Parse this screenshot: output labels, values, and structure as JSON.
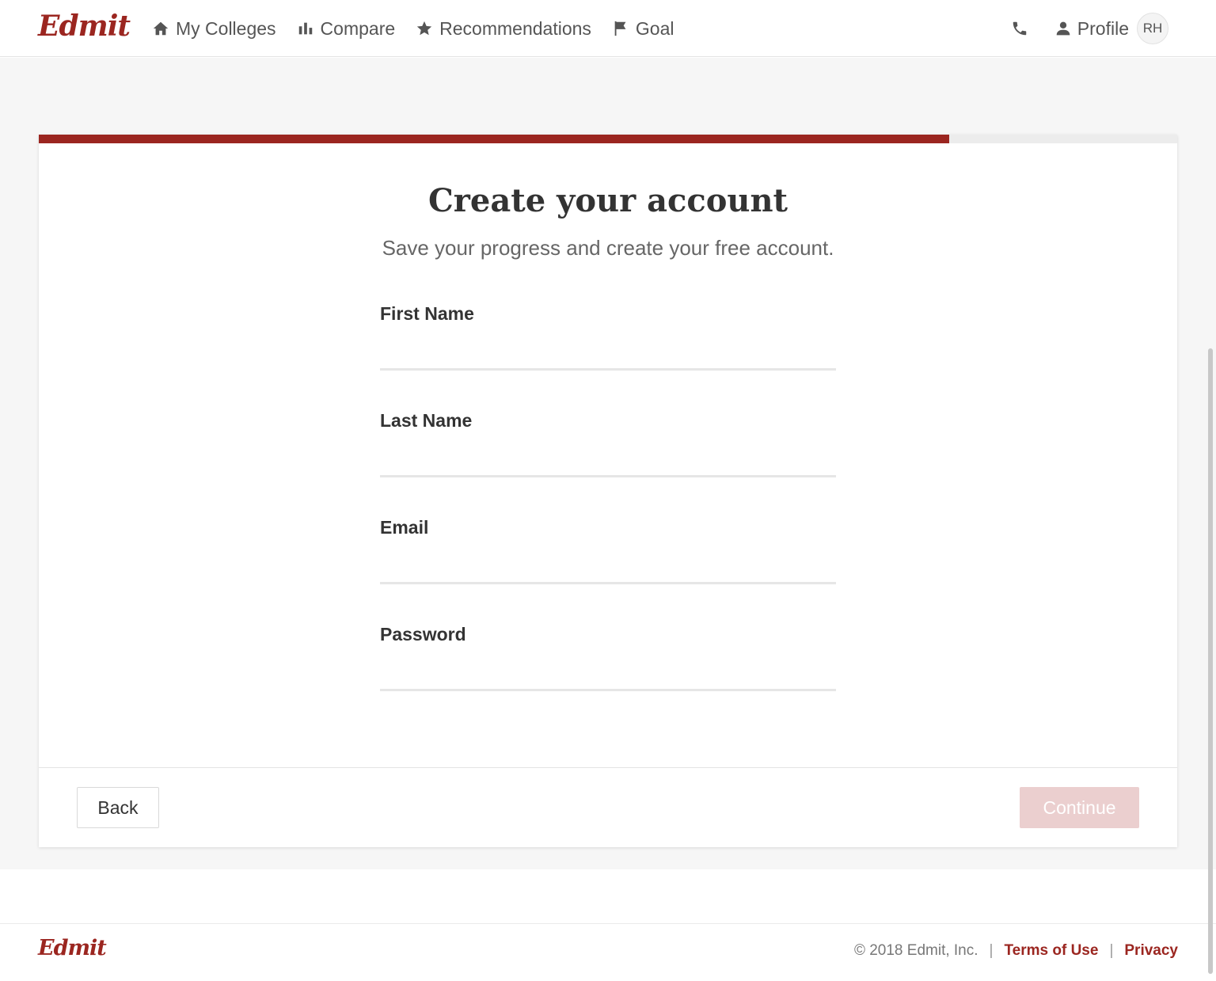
{
  "header": {
    "logo": "Edmit",
    "nav": [
      {
        "label": "My Colleges",
        "icon": "home-icon"
      },
      {
        "label": "Compare",
        "icon": "bar-chart-icon"
      },
      {
        "label": "Recommendations",
        "icon": "star-icon"
      },
      {
        "label": "Goal",
        "icon": "flag-icon"
      }
    ],
    "phone_icon": "phone-icon",
    "profile_label": "Profile",
    "avatar_initials": "RH"
  },
  "progress": {
    "fraction": 0.8,
    "fill_color": "#9b2620",
    "track_color": "#ececec"
  },
  "form": {
    "title": "Create your account",
    "subtitle": "Save your progress and create your free account.",
    "fields": [
      {
        "label": "First Name",
        "value": "",
        "type": "text"
      },
      {
        "label": "Last Name",
        "value": "",
        "type": "text"
      },
      {
        "label": "Email",
        "value": "",
        "type": "email"
      },
      {
        "label": "Password",
        "value": "",
        "type": "password"
      }
    ],
    "back_label": "Back",
    "continue_label": "Continue"
  },
  "footer": {
    "logo": "Edmit",
    "copyright": "© 2018 Edmit, Inc.",
    "terms_label": "Terms of Use",
    "privacy_label": "Privacy",
    "separator": "|"
  },
  "colors": {
    "brand": "#9b2620",
    "continue_disabled": "#ebcfcf",
    "background_band": "#f6f6f6"
  }
}
